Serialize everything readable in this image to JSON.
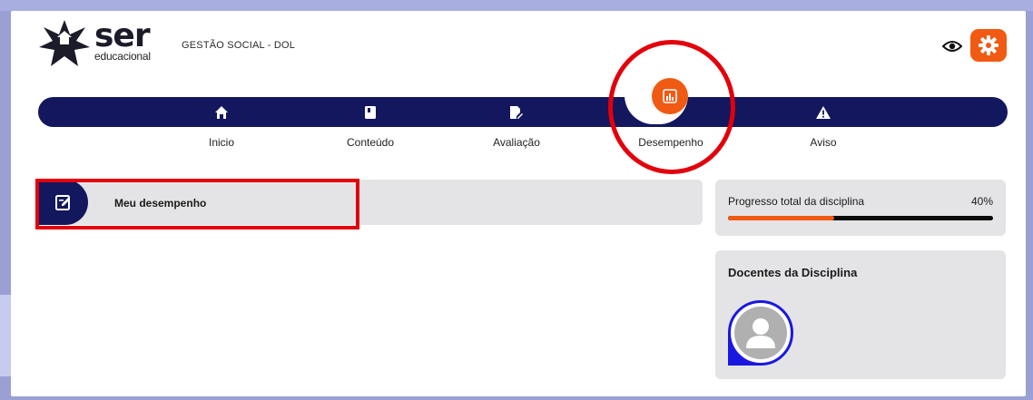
{
  "header": {
    "logo_main": "ser",
    "logo_sub": "educacional",
    "app_title": "GESTÃO SOCIAL - DOL",
    "icons": {
      "visibility": "eye-icon",
      "settings": "gear-icon"
    }
  },
  "nav": {
    "items": [
      {
        "label": "Inicio",
        "icon": "home-icon"
      },
      {
        "label": "Conteúdo",
        "icon": "book-icon"
      },
      {
        "label": "Avaliação",
        "icon": "edit-document-icon"
      },
      {
        "label": "Desempenho",
        "icon": "bar-chart-icon",
        "active": true
      },
      {
        "label": "Aviso",
        "icon": "warning-icon"
      }
    ]
  },
  "main": {
    "performance_card": {
      "label": "Meu desempenho",
      "icon": "edit-note-icon"
    }
  },
  "sidebar": {
    "progress": {
      "title": "Progresso total da disciplina",
      "value_text": "40%",
      "value": 0.4
    },
    "docentes": {
      "title": "Docentes da Disciplina"
    }
  },
  "colors": {
    "brand_navy": "#13175e",
    "accent_orange": "#f05a12",
    "annotation_red": "#e3000b",
    "card_gray": "#e4e4e6"
  }
}
